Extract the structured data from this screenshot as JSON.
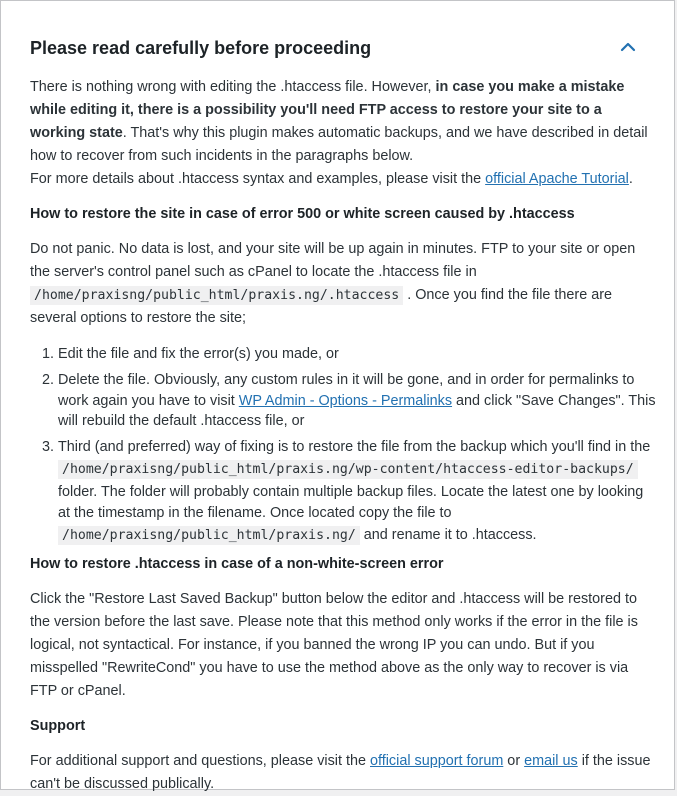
{
  "panel": {
    "title": "Please read carefully before proceeding",
    "toggle_icon": "chevron-up-icon"
  },
  "intro": {
    "p1_a": "There is nothing wrong with editing the .htaccess file. However, ",
    "p1_b": "in case you make a mistake while editing it, there is a possibility you'll need FTP access to restore your site to a working state",
    "p1_c": ". That's why this plugin makes automatic backups, and we have described in detail how to recover from such incidents in the paragraphs below.",
    "p2_a": "For more details about .htaccess syntax and examples, please visit the ",
    "p2_link": "official Apache Tutorial",
    "p2_b": "."
  },
  "section1": {
    "heading": "How to restore the site in case of error 500 or white screen caused by .htaccess",
    "p_a": "Do not panic. No data is lost, and your site will be up again in minutes. FTP to your site or open the server's control panel such as cPanel to locate the .htaccess file in ",
    "p_code": "/home/praxisng/public_html/praxis.ng/.htaccess",
    "p_b": " . Once you find the file there are several options to restore the site;",
    "steps": {
      "s1": "Edit the file and fix the error(s) you made, or",
      "s2_a": "Delete the file. Obviously, any custom rules in it will be gone, and in order for permalinks to work again you have to visit ",
      "s2_link": "WP Admin - Options - Permalinks",
      "s2_b": " and click \"Save Changes\". This will rebuild the default .htaccess file, or",
      "s3_a": "Third (and preferred) way of fixing is to restore the file from the backup which you'll find in the ",
      "s3_code1": "/home/praxisng/public_html/praxis.ng/wp-content/htaccess-editor-backups/",
      "s3_b": " folder. The folder will probably contain multiple backup files. Locate the latest one by looking at the timestamp in the filename. Once located copy the file to ",
      "s3_code2": "/home/praxisng/public_html/praxis.ng/",
      "s3_c": " and rename it to .htaccess."
    }
  },
  "section2": {
    "heading": "How to restore .htaccess in case of a non-white-screen error",
    "p": "Click the \"Restore Last Saved Backup\" button below the editor and .htaccess will be restored to the version before the last save. Please note that this method only works if the error in the file is logical, not syntactical. For instance, if you banned the wrong IP you can undo. But if you misspelled \"RewriteCond\" you have to use the method above as the only way to recover is via FTP or cPanel."
  },
  "section3": {
    "heading": "Support",
    "p_a": "For additional support and questions, please visit the ",
    "p_link1": "official support forum",
    "p_b": " or ",
    "p_link2": "email us",
    "p_c": " if the issue can't be discussed publically."
  },
  "colors": {
    "link": "#2271b1",
    "text": "#2c3338",
    "panel_bg": "#ffffff",
    "border": "#c3c4c7"
  }
}
